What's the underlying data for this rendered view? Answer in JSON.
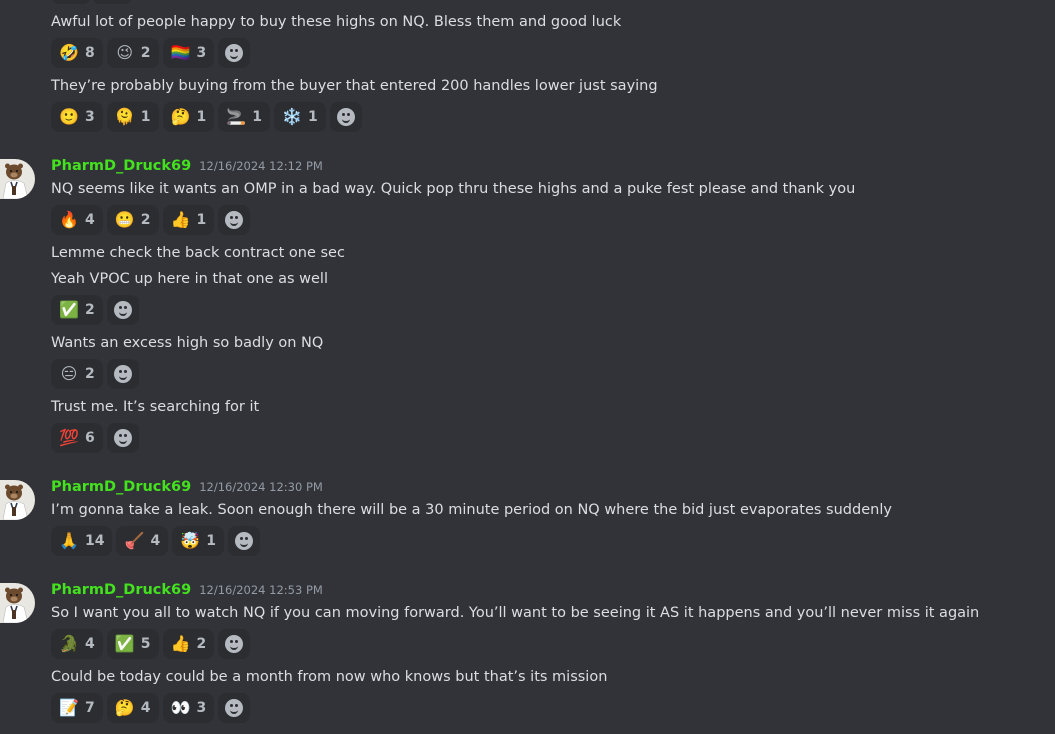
{
  "messages": [
    {
      "type": "continuation",
      "text": "Awful lot of people happy to buy these highs on NQ. Bless them and good luck",
      "reactions": [
        {
          "emoji": "🤣",
          "count": "8",
          "name": "rofl-emoji"
        },
        {
          "emoji": "😉",
          "count": "2",
          "name": "wink-emoji"
        },
        {
          "emoji": "🏳️‍🌈",
          "count": "3",
          "name": "rainbow-flag-emoji"
        }
      ]
    },
    {
      "type": "continuation",
      "text": "They’re probably buying from the buyer that entered 200 handles lower just saying",
      "reactions": [
        {
          "emoji": "🙂",
          "count": "3",
          "name": "slight-smile-emoji"
        },
        {
          "emoji": "🫠",
          "count": "1",
          "name": "melting-face-emoji"
        },
        {
          "emoji": "🤔",
          "count": "1",
          "name": "thinking-emoji"
        },
        {
          "emoji": "🚬",
          "count": "1",
          "name": "cigarette-emoji"
        },
        {
          "emoji": "❄️",
          "count": "1",
          "name": "snowflake-emoji"
        }
      ]
    },
    {
      "type": "header",
      "username": "PharmD_Druck69",
      "timestamp": "12/16/2024 12:12 PM",
      "text": "NQ seems like it wants an OMP in a bad way. Quick pop thru these highs and a puke fest please and thank you",
      "reactions": [
        {
          "emoji": "🔥",
          "count": "4",
          "name": "fire-emoji"
        },
        {
          "emoji": "😬",
          "count": "2",
          "name": "grimace-emoji"
        },
        {
          "emoji": "👍",
          "count": "1",
          "name": "thumbs-up-emoji"
        }
      ]
    },
    {
      "type": "continuation",
      "text": "Lemme check the back contract one sec",
      "reactions": []
    },
    {
      "type": "continuation",
      "text": "Yeah VPOC up here in that one as well",
      "reactions": [
        {
          "emoji": "✅",
          "count": "2",
          "name": "check-mark-emoji"
        }
      ]
    },
    {
      "type": "continuation",
      "text": "Wants an excess high so badly on NQ",
      "reactions": [
        {
          "emoji": "😑",
          "count": "2",
          "name": "expressionless-emoji"
        }
      ]
    },
    {
      "type": "continuation",
      "text": "Trust me. It’s searching for it",
      "reactions": [
        {
          "emoji": "💯",
          "count": "6",
          "name": "hundred-emoji"
        }
      ]
    },
    {
      "type": "header",
      "username": "PharmD_Druck69",
      "timestamp": "12/16/2024 12:30 PM",
      "text": "I’m gonna take a leak. Soon enough there will be a 30 minute period on NQ where the bid just evaporates suddenly",
      "reactions": [
        {
          "emoji": "🙏",
          "count": "14",
          "name": "pray-emoji"
        },
        {
          "emoji": "🪠",
          "count": "4",
          "name": "plunger-emoji"
        },
        {
          "emoji": "🤯",
          "count": "1",
          "name": "exploding-head-emoji"
        }
      ]
    },
    {
      "type": "header",
      "username": "PharmD_Druck69",
      "timestamp": "12/16/2024 12:53 PM",
      "text": "So I want you all to watch NQ if you can moving forward. You’ll want to be seeing it AS it happens and you’ll never miss it again",
      "reactions": [
        {
          "emoji": "🐊",
          "count": "4",
          "name": "crocodile-emoji"
        },
        {
          "emoji": "✅",
          "count": "5",
          "name": "check-mark-emoji"
        },
        {
          "emoji": "👍",
          "count": "2",
          "name": "thumbs-up-emoji"
        }
      ]
    },
    {
      "type": "continuation",
      "text": "Could be today could be a month from now who knows but that’s its mission",
      "reactions": [
        {
          "emoji": "📝",
          "count": "7",
          "name": "memo-emoji"
        },
        {
          "emoji": "🤔",
          "count": "4",
          "name": "thinking-emoji"
        },
        {
          "emoji": "👀",
          "count": "3",
          "name": "eyes-emoji"
        }
      ]
    }
  ]
}
